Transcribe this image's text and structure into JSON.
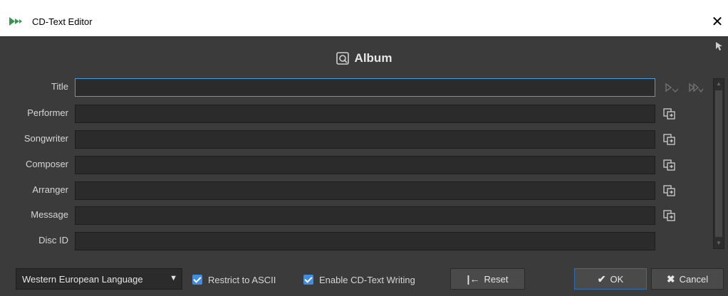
{
  "window": {
    "title": "CD-Text Editor",
    "close_glyph": "✕",
    "icon": "app-logo-icon"
  },
  "section": {
    "title": "Album",
    "icon": "album-disc-icon"
  },
  "fields": [
    {
      "label": "Title",
      "value": "",
      "active": true,
      "copy_icon": false
    },
    {
      "label": "Performer",
      "value": "",
      "copy_icon": true
    },
    {
      "label": "Songwriter",
      "value": "",
      "copy_icon": true
    },
    {
      "label": "Composer",
      "value": "",
      "copy_icon": true
    },
    {
      "label": "Arranger",
      "value": "",
      "copy_icon": true
    },
    {
      "label": "Message",
      "value": "",
      "copy_icon": true
    },
    {
      "label": "Disc ID",
      "value": "",
      "copy_icon": false
    }
  ],
  "footer": {
    "language": "Western European Language",
    "language_arrow": "▼",
    "restrict_ascii_label": "Restrict to ASCII",
    "restrict_ascii_checked": true,
    "enable_writing_label": "Enable CD-Text Writing",
    "enable_writing_checked": true,
    "reset_label": "Reset",
    "reset_glyph": "|←",
    "ok_label": "OK",
    "ok_glyph": "✔",
    "cancel_label": "Cancel",
    "cancel_glyph": "✖"
  },
  "colors": {
    "background": "#3b3b3b",
    "input_bg": "#2b2b2b",
    "accent": "#3d8ee0",
    "icon": "#cfcfcf"
  }
}
